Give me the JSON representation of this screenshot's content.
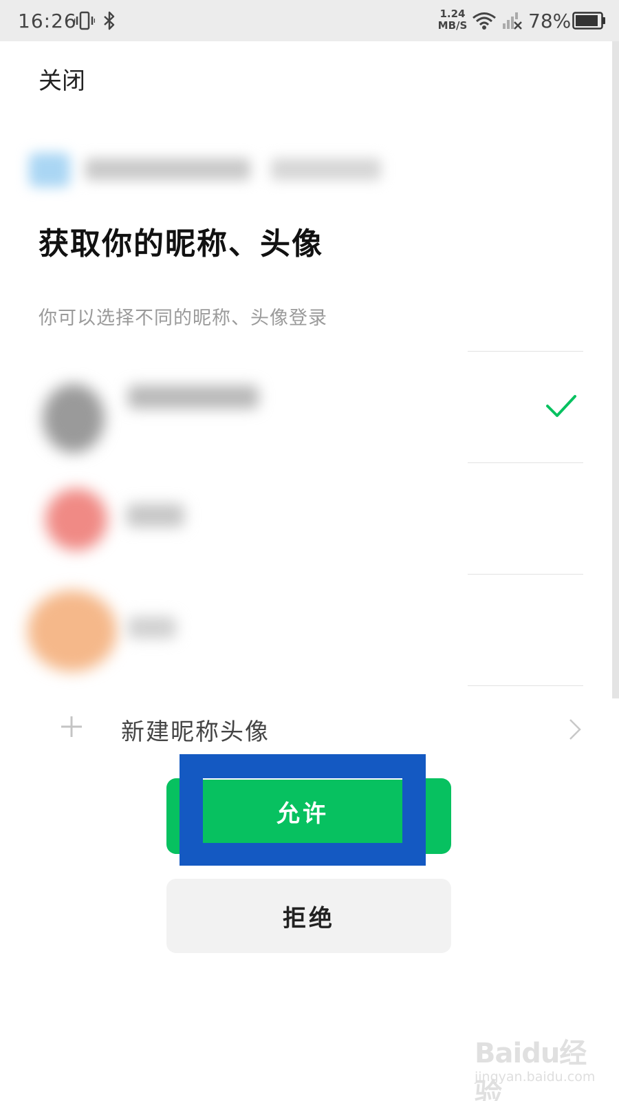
{
  "status_bar": {
    "time": "16:26",
    "net_speed_value": "1.24",
    "net_speed_unit": "MB/S",
    "battery_percent": "78%",
    "icons": [
      "vibrate-icon",
      "bluetooth-icon",
      "wifi-icon",
      "cellular-signal-icon",
      "battery-icon"
    ]
  },
  "header": {
    "close_label": "关闭"
  },
  "auth": {
    "title": "获取你的昵称、头像",
    "subtitle": "你可以选择不同的昵称、头像登录",
    "accounts": [
      {
        "avatar_color": "#9a9a9a",
        "selected": true
      },
      {
        "avatar_color": "#f08a85",
        "selected": false
      },
      {
        "avatar_color": "#f5b88a",
        "selected": false
      }
    ],
    "new_profile_label": "新建昵称头像",
    "allow_label": "允许",
    "reject_label": "拒绝"
  },
  "colors": {
    "accent_green": "#07c160",
    "highlight_blue": "#1459c2",
    "check_green": "#07c160"
  },
  "watermark": {
    "brand": "Baidu经验",
    "url": "jingyan.baidu.com"
  }
}
